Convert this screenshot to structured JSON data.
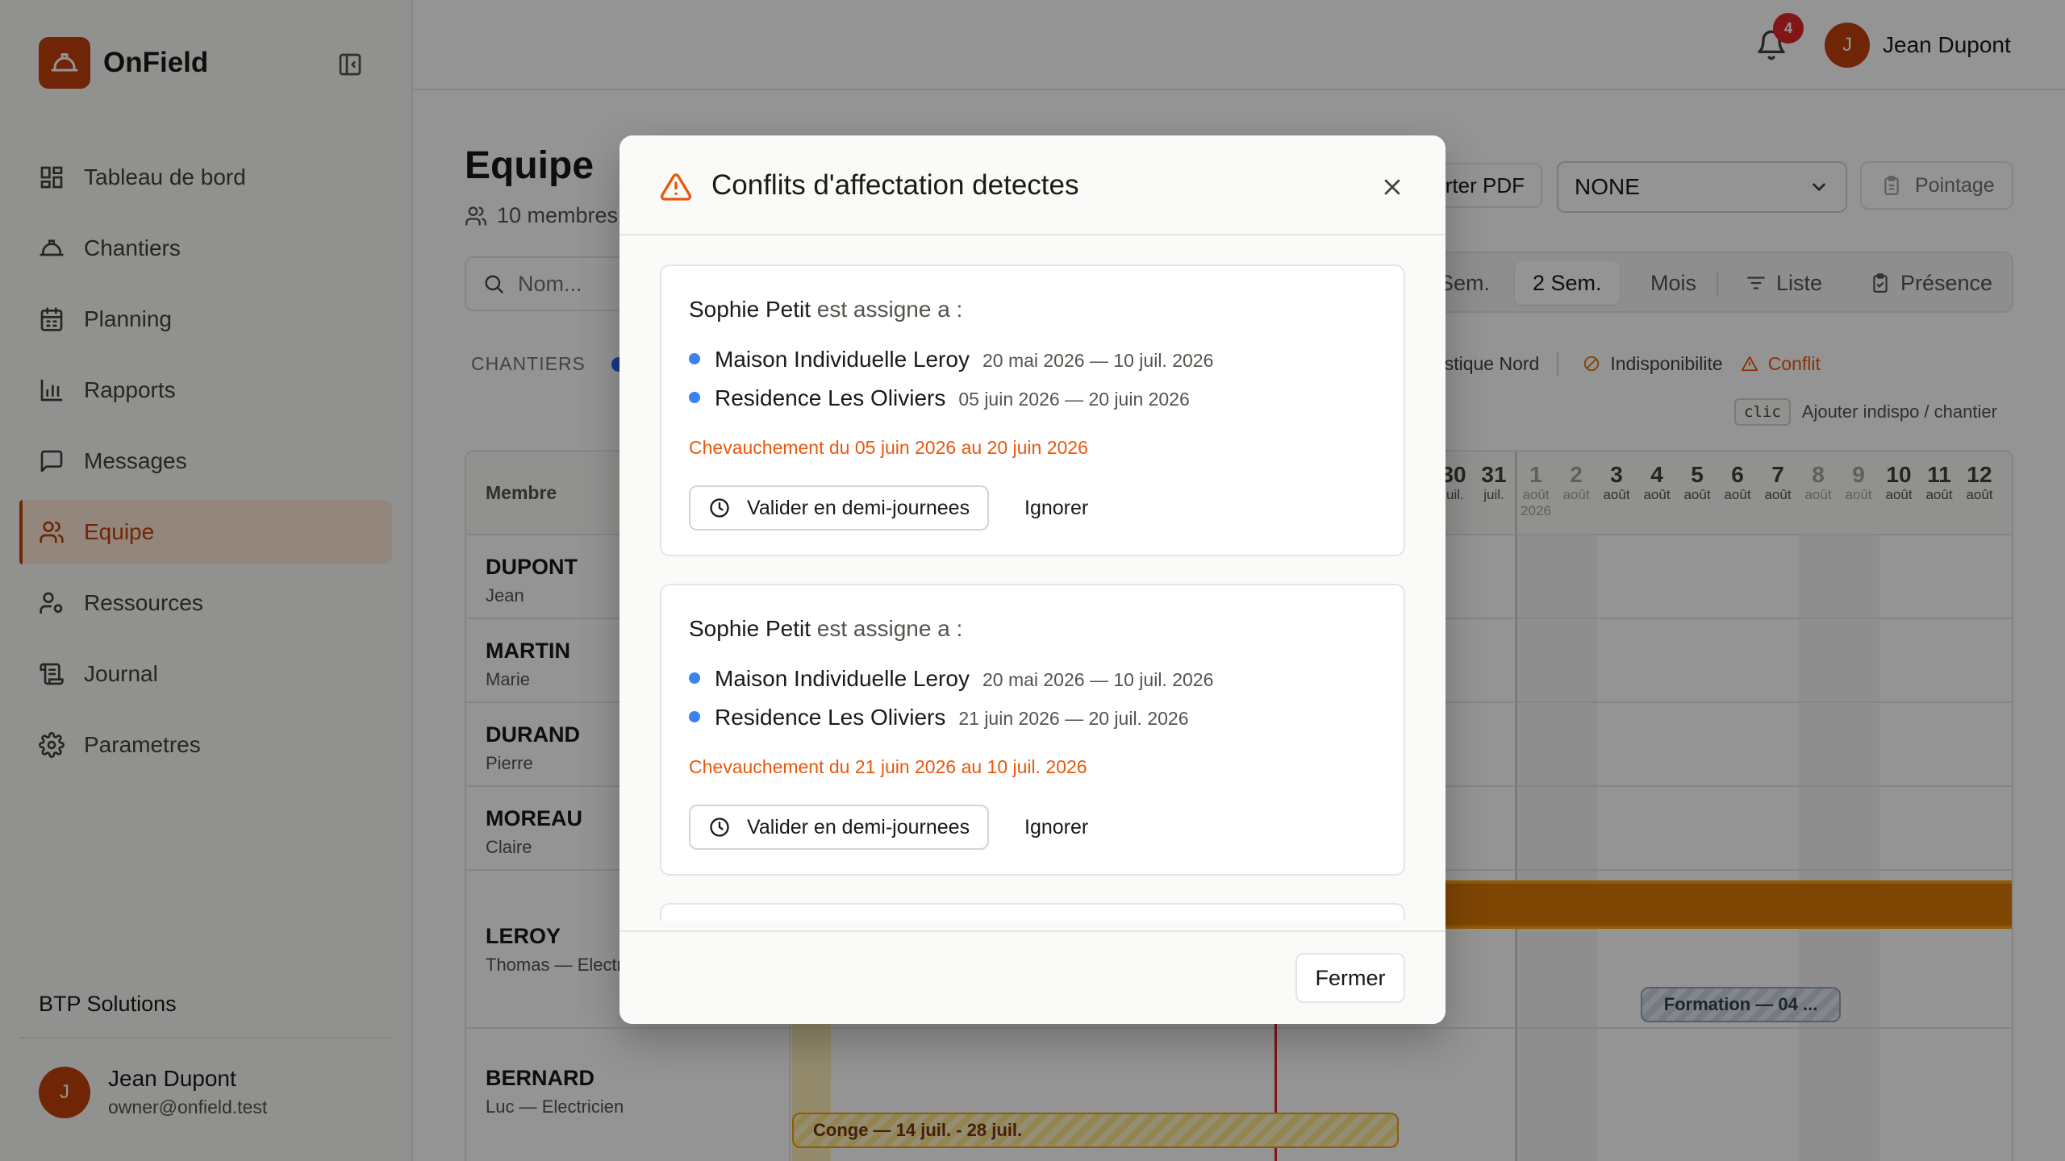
{
  "app": {
    "name": "OnField"
  },
  "sidebar": {
    "items": [
      {
        "label": "Tableau de bord",
        "icon": "dashboard-icon"
      },
      {
        "label": "Chantiers",
        "icon": "hard-hat-icon"
      },
      {
        "label": "Planning",
        "icon": "calendar-icon"
      },
      {
        "label": "Rapports",
        "icon": "bar-chart-icon"
      },
      {
        "label": "Messages",
        "icon": "message-icon"
      },
      {
        "label": "Equipe",
        "icon": "users-icon",
        "active": true
      },
      {
        "label": "Ressources",
        "icon": "user-cog-icon"
      },
      {
        "label": "Journal",
        "icon": "scroll-icon"
      },
      {
        "label": "Parametres",
        "icon": "gear-icon"
      }
    ],
    "org_name": "BTP Solutions",
    "user": {
      "initial": "J",
      "name": "Jean Dupont",
      "email": "owner@onfield.test"
    }
  },
  "topbar": {
    "notification_count": "4",
    "user_initial": "J",
    "user_name": "Jean Dupont"
  },
  "page": {
    "title": "Equipe",
    "member_count": "10 membres",
    "search_placeholder": "Nom...",
    "export_label": "rter PDF",
    "select_value": "NONE",
    "pointage_label": "Pointage",
    "views": [
      {
        "label": "Sem."
      },
      {
        "label": "2 Sem.",
        "active": true
      },
      {
        "label": "Mois"
      },
      {
        "label": "Liste"
      },
      {
        "label": "Présence"
      }
    ],
    "chantiers_label": "CHANTIERS",
    "legend": {
      "logistique": "ogistique Nord",
      "indispo": "Indisponibilite",
      "conflit": "Conflit"
    },
    "hint_key": "clic",
    "hint_text": "Ajouter indispo / chantier"
  },
  "grid": {
    "header_label": "Membre",
    "days": [
      {
        "num": "30",
        "mon": "juil."
      },
      {
        "num": "31",
        "mon": "juil."
      },
      {
        "num": "1",
        "mon": "août 2026",
        "weekend": true
      },
      {
        "num": "2",
        "mon": "août",
        "weekend": true
      },
      {
        "num": "3",
        "mon": "août"
      },
      {
        "num": "4",
        "mon": "août"
      },
      {
        "num": "5",
        "mon": "août"
      },
      {
        "num": "6",
        "mon": "août"
      },
      {
        "num": "7",
        "mon": "août"
      },
      {
        "num": "8",
        "mon": "août",
        "weekend": true
      },
      {
        "num": "9",
        "mon": "août",
        "weekend": true
      },
      {
        "num": "10",
        "mon": "août"
      },
      {
        "num": "11",
        "mon": "août"
      },
      {
        "num": "12",
        "mon": "août"
      }
    ],
    "members": [
      {
        "last": "DUPONT",
        "first": "Jean"
      },
      {
        "last": "MARTIN",
        "first": "Marie"
      },
      {
        "last": "DURAND",
        "first": "Pierre"
      },
      {
        "last": "MOREAU",
        "first": "Claire"
      },
      {
        "last": "LEROY",
        "first": "Thomas — Electri"
      },
      {
        "last": "BERNARD",
        "first": "Luc — Electricien"
      }
    ],
    "formation_label": "Formation — 04 ...",
    "conge_label": "Conge — 14 juil. - 28 juil."
  },
  "modal": {
    "title": "Conflits d'affectation detectes",
    "close_label": "Fermer",
    "conflicts": [
      {
        "person": "Sophie Petit",
        "assigned_text": "est assigne a :",
        "sites": [
          {
            "name": "Maison Individuelle Leroy",
            "dates": "20 mai 2026 — 10 juil. 2026"
          },
          {
            "name": "Residence Les Oliviers",
            "dates": "05 juin 2026 — 20 juin 2026"
          }
        ],
        "overlap": "Chevauchement du 05 juin 2026 au 20 juin 2026",
        "validate_label": "Valider en demi-journees",
        "ignore_label": "Ignorer"
      },
      {
        "person": "Sophie Petit",
        "assigned_text": "est assigne a :",
        "sites": [
          {
            "name": "Maison Individuelle Leroy",
            "dates": "20 mai 2026 — 10 juil. 2026"
          },
          {
            "name": "Residence Les Oliviers",
            "dates": "21 juin 2026 — 20 juil. 2026"
          }
        ],
        "overlap": "Chevauchement du 21 juin 2026 au 10 juil. 2026",
        "validate_label": "Valider en demi-journees",
        "ignore_label": "Ignorer"
      }
    ]
  },
  "colors": {
    "brand": "#c2410c",
    "conflict": "#ea580c",
    "site_dot": "#3b82f6",
    "today": "#dc2626"
  }
}
